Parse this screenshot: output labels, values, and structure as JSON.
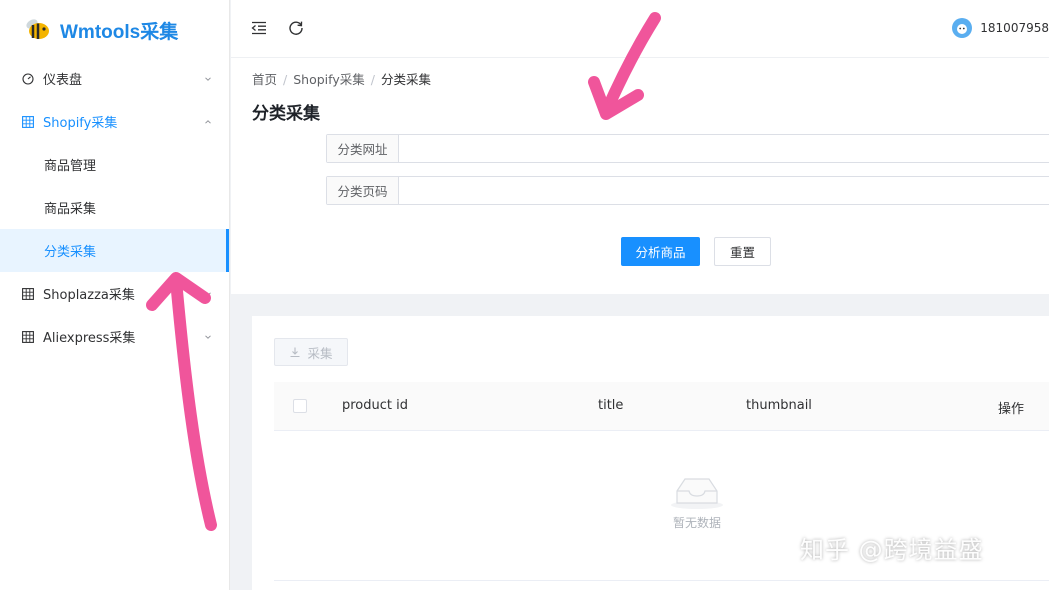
{
  "app": {
    "title": "Wmtools采集"
  },
  "sidebar": {
    "items": [
      {
        "label": "仪表盘",
        "icon": "dashboard-icon"
      },
      {
        "label": "Shopify采集",
        "icon": "grid-icon",
        "children": [
          {
            "label": "商品管理"
          },
          {
            "label": "商品采集"
          },
          {
            "label": "分类采集"
          }
        ]
      },
      {
        "label": "Shoplazza采集",
        "icon": "grid-icon"
      },
      {
        "label": "Aliexpress采集",
        "icon": "grid-icon"
      }
    ]
  },
  "header": {
    "user": "181007958"
  },
  "breadcrumb": [
    "首页",
    "Shopify采集",
    "分类采集"
  ],
  "page": {
    "title": "分类采集",
    "fields": [
      {
        "label": "分类网址",
        "value": ""
      },
      {
        "label": "分类页码",
        "value": ""
      }
    ],
    "analyze_button": "分析商品",
    "reset_button": "重置"
  },
  "table": {
    "collect_button": "采集",
    "columns": [
      "product id",
      "title",
      "thumbnail",
      "操作"
    ],
    "empty_text": "暂无数据"
  },
  "watermark": "知乎 @跨境益盛",
  "colors": {
    "primary": "#1890ff",
    "logo": "#1e88e5",
    "arrow": "#f0559b"
  }
}
